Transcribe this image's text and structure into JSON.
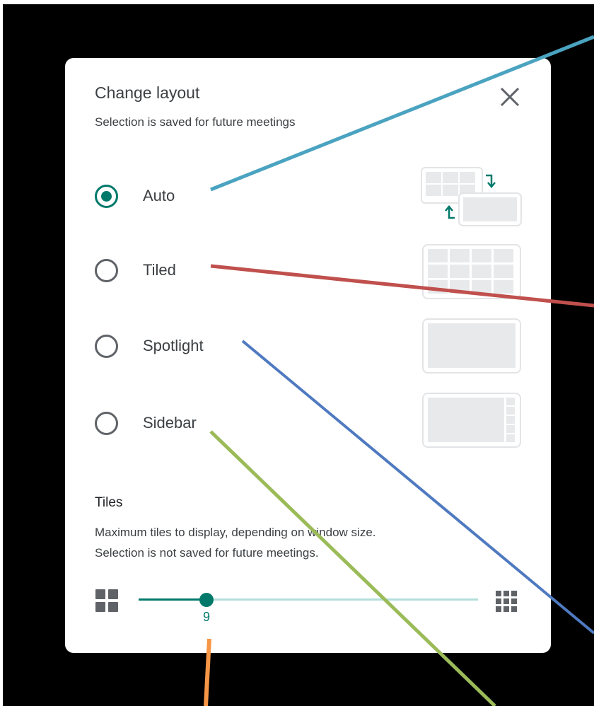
{
  "dialog": {
    "title": "Change layout",
    "subtitle": "Selection is saved for future meetings",
    "close_icon": "close-icon"
  },
  "options": [
    {
      "label": "Auto",
      "checked": true,
      "thumbnail": "auto-layout-icon"
    },
    {
      "label": "Tiled",
      "checked": false,
      "thumbnail": "tiled-layout-icon"
    },
    {
      "label": "Spotlight",
      "checked": false,
      "thumbnail": "spotlight-layout-icon"
    },
    {
      "label": "Sidebar",
      "checked": false,
      "thumbnail": "sidebar-layout-icon"
    }
  ],
  "tiles": {
    "title": "Tiles",
    "description_line1": "Maximum tiles to display, depending on window size.",
    "description_line2": "Selection is not saved for future meetings.",
    "slider_value": "9",
    "slider_fraction": 0.2,
    "min_icon": "few-tiles-grid-icon",
    "max_icon": "many-tiles-grid-icon"
  },
  "colors": {
    "accent": "#00796b",
    "track_inactive": "#b2dfdb",
    "annotation_cyan": "#4aa3c0",
    "annotation_red": "#c0504d",
    "annotation_blue": "#4f7ac0",
    "annotation_green": "#9bbb59",
    "annotation_orange": "#f79646"
  }
}
